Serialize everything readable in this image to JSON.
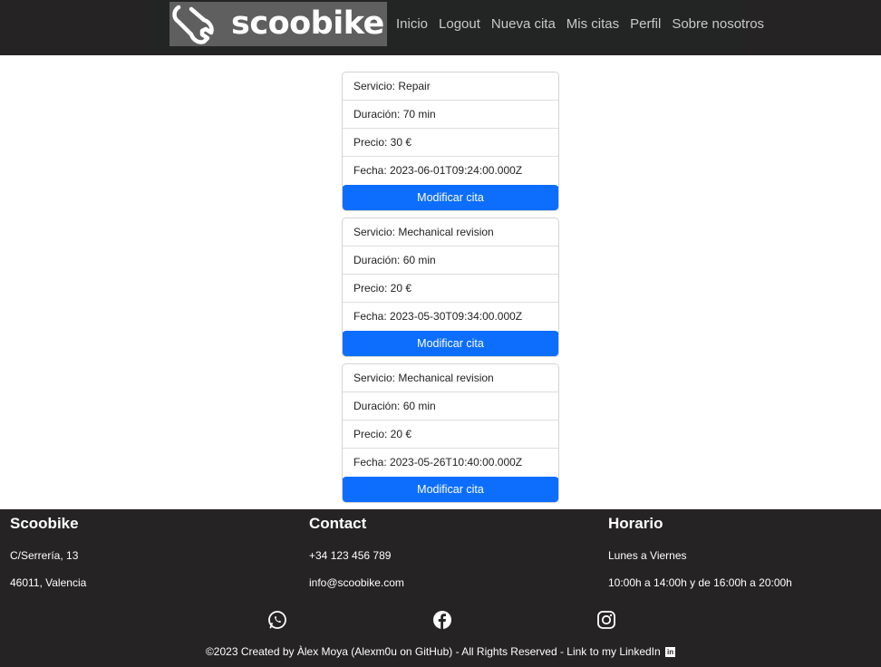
{
  "brand": {
    "name": "scoobike"
  },
  "nav": {
    "items": [
      "Inicio",
      "Logout",
      "Nueva cita",
      "Mis citas",
      "Perfil",
      "Sobre nosotros"
    ]
  },
  "appointments": [
    {
      "servicio": "Servicio: Repair",
      "duracion": "Duración: 70 min",
      "precio": "Precio: 30 €",
      "fecha": "Fecha: 2023-06-01T09:24:00.000Z",
      "button": "Modificar cita"
    },
    {
      "servicio": "Servicio: Mechanical revision",
      "duracion": "Duración: 60 min",
      "precio": "Precio: 20 €",
      "fecha": "Fecha: 2023-05-30T09:34:00.000Z",
      "button": "Modificar cita"
    },
    {
      "servicio": "Servicio: Mechanical revision",
      "duracion": "Duración: 60 min",
      "precio": "Precio: 20 €",
      "fecha": "Fecha: 2023-05-26T10:40:00.000Z",
      "button": "Modificar cita"
    }
  ],
  "footer": {
    "company": {
      "title": "Scoobike",
      "line1": "C/Serrería, 13",
      "line2": "46011, Valencia"
    },
    "contact": {
      "title": "Contact",
      "line1": "+34 123 456 789",
      "line2": "info@scoobike.com"
    },
    "hours": {
      "title": "Horario",
      "line1": "Lunes a Viernes",
      "line2": "10:00h a 14:00h y de 16:00h a 20:00h"
    },
    "social": [
      "whatsapp-icon",
      "facebook-icon",
      "instagram-icon"
    ],
    "copyright": "©2023 Created by Àlex Moya (Alexm0u on GitHub) - All Rights Reserved - Link to my LinkedIn",
    "linkedin_glyph": "in"
  },
  "colors": {
    "header_bg": "#252323",
    "button_bg": "#0d6efd",
    "logo_bg": "#5f5f5f"
  }
}
